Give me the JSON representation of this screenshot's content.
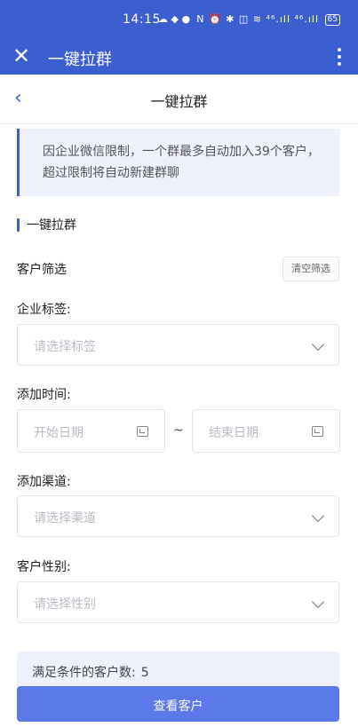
{
  "status_bar": {
    "time": "14:15",
    "notification_icons": "☁ ◆ ●",
    "right_icons": "N ⏰ ✱ ◫ ≋ ⁴⁶.ıll ⁴⁶.ıll",
    "battery": "65"
  },
  "app_bar": {
    "close_icon": "close-icon",
    "title": "一键拉群",
    "more_icon": "more-vert-icon"
  },
  "nav_bar": {
    "back_icon": "chevron-left-icon",
    "title": "一键拉群"
  },
  "notice": {
    "text": "因企业微信限制，一个群最多自动加入39个客户，超过限制将自动新建群聊"
  },
  "section": {
    "title": "一键拉群"
  },
  "filter": {
    "label": "客户筛选",
    "clear_label": "清空筛选"
  },
  "fields": {
    "tag": {
      "label": "企业标签:",
      "placeholder": "请选择标签"
    },
    "time": {
      "label": "添加时间:",
      "start_placeholder": "开始日期",
      "end_placeholder": "结束日期",
      "separator": "~"
    },
    "channel": {
      "label": "添加渠道:",
      "placeholder": "请选择渠道"
    },
    "gender": {
      "label": "客户性别:",
      "placeholder": "请选择性别"
    }
  },
  "result": {
    "label": "满足条件的客户数:",
    "count": "5"
  },
  "actions": {
    "view_customers": "查看客户"
  },
  "colors": {
    "brand": "#3c5fd0",
    "button": "#5b79e8",
    "notice_bg": "#eef1fc"
  }
}
